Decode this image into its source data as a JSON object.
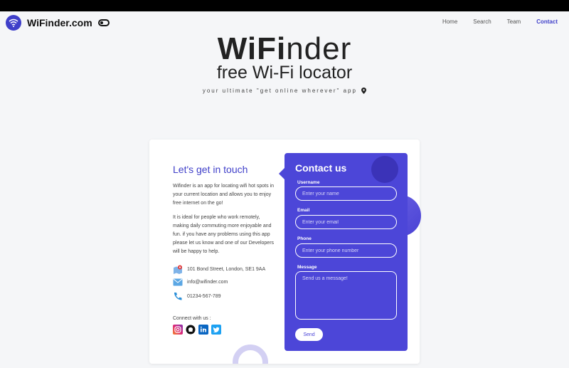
{
  "header": {
    "brand": "WiFinder.com",
    "nav": [
      "Home",
      "Search",
      "Team",
      "Contact"
    ],
    "active_nav": "Contact"
  },
  "hero": {
    "title_bold": "WiFi",
    "title_rest": "nder",
    "subtitle": "free Wi-Fi locator",
    "tagline": "your ultimate \"get online wherever\" app"
  },
  "contact_info": {
    "heading": "Let's get in touch",
    "paragraph1": "Wifinder is an app for locating wifi hot spots in your current location and allows you to enjoy free internet on the go!",
    "paragraph2": "It is ideal for people who work remotely, making daily commuting more enjoyable and fun. if you have any problems using this app please let us know and one of our Developers will be happy to help.",
    "address": "101 Bond Street, London, SE1 9AA",
    "email": "info@wifinder.com",
    "phone": "01234-567-789",
    "connect_label": "Connect with us :"
  },
  "form": {
    "title": "Contact us",
    "username_label": "Username",
    "username_placeholder": "Enter your name",
    "email_label": "Email",
    "email_placeholder": "Enter your email",
    "phone_label": "Phone",
    "phone_placeholder": "Enter your phone number",
    "message_label": "Message",
    "message_placeholder": "Send us a message!",
    "send_label": "Send"
  },
  "icons": [
    "wifi-icon",
    "toggle-icon",
    "location-pin-icon",
    "map-icon",
    "mail-icon",
    "phone-icon",
    "instagram-icon",
    "github-icon",
    "linkedin-icon",
    "twitter-icon"
  ],
  "colors": {
    "accent": "#3f3fc9",
    "panel": "#4c46d8",
    "background": "#f5f6f8"
  }
}
